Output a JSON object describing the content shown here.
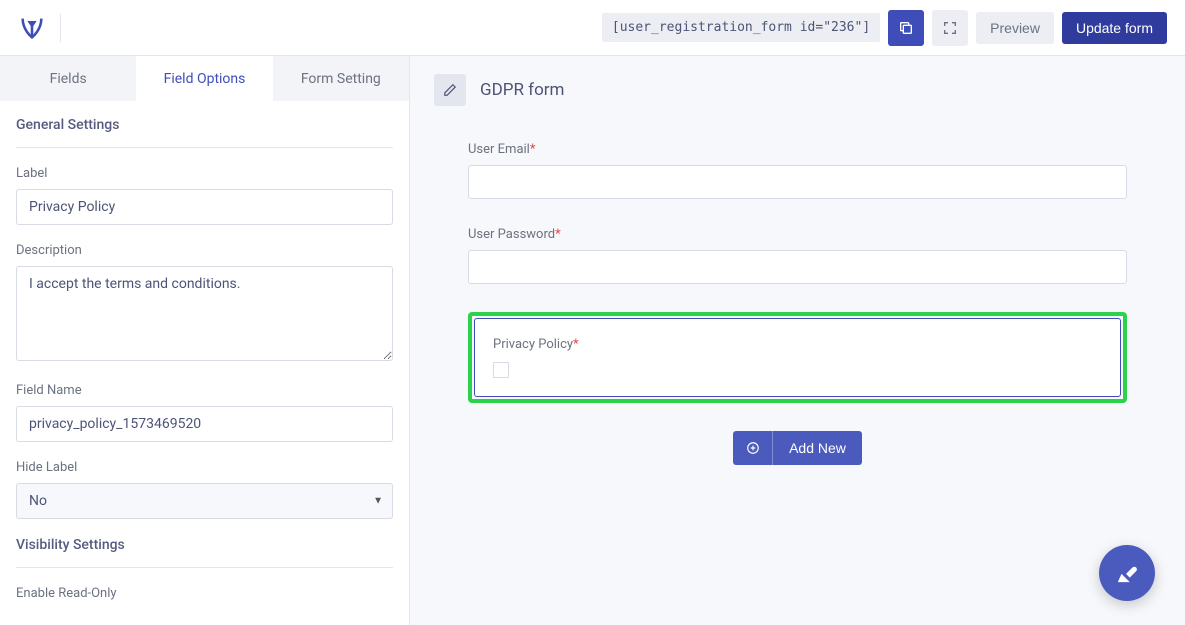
{
  "header": {
    "shortcode": "[user_registration_form id=\"236\"]",
    "preview_label": "Preview",
    "update_label": "Update form"
  },
  "tabs": {
    "fields": "Fields",
    "field_options": "Field Options",
    "form_setting": "Form Setting"
  },
  "sidebar": {
    "general_title": "General Settings",
    "label_label": "Label",
    "label_value": "Privacy Policy",
    "description_label": "Description",
    "description_value": "I accept the terms and conditions.",
    "field_name_label": "Field Name",
    "field_name_value": "privacy_policy_1573469520",
    "hide_label_label": "Hide Label",
    "hide_label_value": "No",
    "visibility_title": "Visibility Settings",
    "enable_readonly_label": "Enable Read-Only"
  },
  "canvas": {
    "form_title": "GDPR form",
    "fields": {
      "email_label": "User Email",
      "password_label": "User Password",
      "privacy_label": "Privacy Policy"
    },
    "add_new_label": "Add New"
  }
}
